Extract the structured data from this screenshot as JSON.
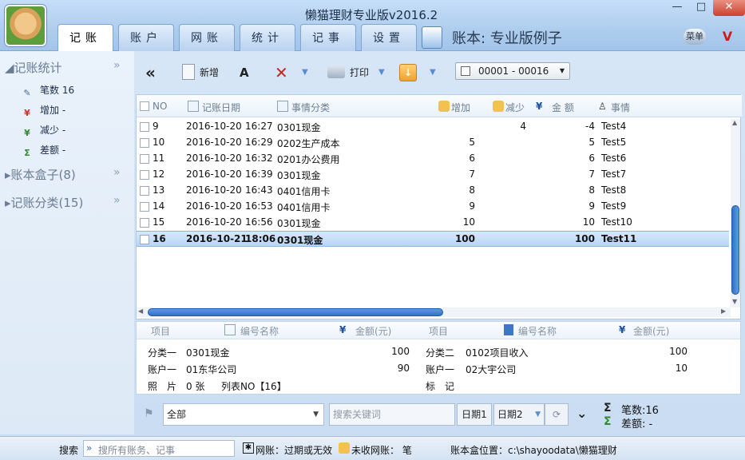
{
  "window": {
    "title": "懒猫理财专业版v2016.2",
    "minimize": "—",
    "maximize": "□",
    "close": "✕"
  },
  "tabs": [
    {
      "label": "记账",
      "active": true
    },
    {
      "label": "账户",
      "active": false
    },
    {
      "label": "网账",
      "active": false
    },
    {
      "label": "统计",
      "active": false
    },
    {
      "label": "记事",
      "active": false
    },
    {
      "label": "设置",
      "active": false
    }
  ],
  "header": {
    "book_name": "账本: 专业版例子",
    "menu_label": "菜单"
  },
  "sidebar": {
    "stats_title": "记账统计",
    "stats": [
      {
        "label": "笔数",
        "value": "16"
      },
      {
        "label": "增加",
        "value": "-"
      },
      {
        "label": "减少",
        "value": "-"
      },
      {
        "label": "差额",
        "value": "-"
      }
    ],
    "boxes_title": "账本盒子(8)",
    "categories_title": "记账分类(15)"
  },
  "toolbar": {
    "new_label": "新增",
    "print_label": "打印",
    "range_value": "00001 - 00016"
  },
  "grid": {
    "headers": [
      "NO",
      "记账日期",
      "事情分类",
      "增加",
      "减少",
      "金 额",
      "事情"
    ],
    "rows": [
      {
        "no": "9",
        "date": "2016-10-20",
        "time": "16:27",
        "category": "0301现金",
        "add": "",
        "sub": "4",
        "amount": "-4",
        "memo": "Test4",
        "selected": false
      },
      {
        "no": "10",
        "date": "2016-10-20",
        "time": "16:29",
        "category": "0202生产成本",
        "add": "5",
        "sub": "",
        "amount": "5",
        "memo": "Test5",
        "selected": false
      },
      {
        "no": "11",
        "date": "2016-10-20",
        "time": "16:32",
        "category": "0201办公费用",
        "add": "6",
        "sub": "",
        "amount": "6",
        "memo": "Test6",
        "selected": false
      },
      {
        "no": "12",
        "date": "2016-10-20",
        "time": "16:39",
        "category": "0301现金",
        "add": "7",
        "sub": "",
        "amount": "7",
        "memo": "Test7",
        "selected": false
      },
      {
        "no": "13",
        "date": "2016-10-20",
        "time": "16:43",
        "category": "0401信用卡",
        "add": "8",
        "sub": "",
        "amount": "8",
        "memo": "Test8",
        "selected": false
      },
      {
        "no": "14",
        "date": "2016-10-20",
        "time": "16:53",
        "category": "0401信用卡",
        "add": "9",
        "sub": "",
        "amount": "9",
        "memo": "Test9",
        "selected": false
      },
      {
        "no": "15",
        "date": "2016-10-20",
        "time": "16:56",
        "category": "0301现金",
        "add": "10",
        "sub": "",
        "amount": "10",
        "memo": "Test10",
        "selected": false
      },
      {
        "no": "16",
        "date": "2016-10-21",
        "time": "18:06",
        "category": "0301现金",
        "add": "100",
        "sub": "",
        "amount": "100",
        "memo": "Test11",
        "selected": true
      }
    ]
  },
  "detail": {
    "headers": [
      "项目",
      "编号名称",
      "金额(元)",
      "项目",
      "编号名称",
      "金额(元)"
    ],
    "left": [
      {
        "label": "分类一",
        "value": "0301现金",
        "amount": "100"
      },
      {
        "label": "账户一",
        "value": "01东华公司",
        "amount": "90"
      }
    ],
    "photo_label": "照　片",
    "photo_value": "0 张",
    "list_value": "列表NO【16】",
    "right": [
      {
        "label": "分类二",
        "value": "0102项目收入",
        "amount": "100"
      },
      {
        "label": "账户一",
        "value": "02大宇公司",
        "amount": "10"
      }
    ],
    "mark_label": "标　记"
  },
  "filter": {
    "scope_value": "全部",
    "search_placeholder": "搜索关键词",
    "date1_label": "日期1",
    "date2_label": "日期2",
    "count_text": "笔数:16",
    "diff_text": "差额: -"
  },
  "status": {
    "search_label": "搜索",
    "search_placeholder": "搜所有账务、记事",
    "net_text": "网账：过期或无效",
    "unreceived_text": "未收网账： 笔",
    "location_text": "账本盒位置：c:\\shayoodata\\懒猫理财"
  }
}
